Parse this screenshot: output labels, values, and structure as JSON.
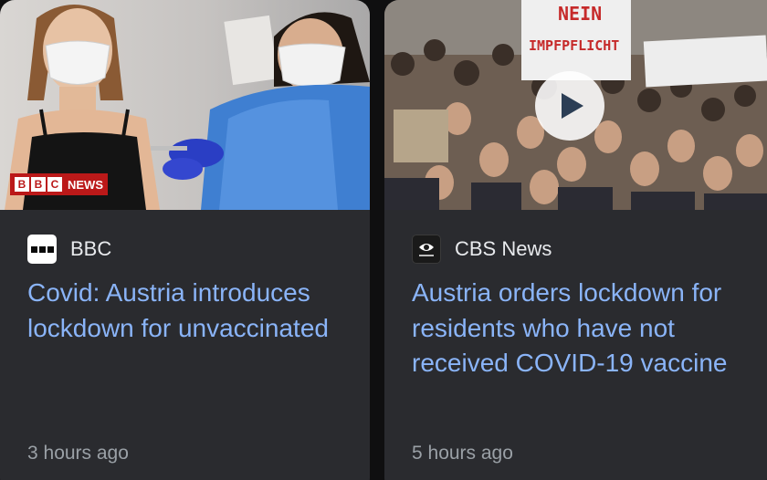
{
  "cards": [
    {
      "source": {
        "name": "BBC",
        "logo_icon": "bbc-logo-icon"
      },
      "thumbnail": {
        "icon": "vaccination-photo",
        "badge": {
          "letters": [
            "B",
            "B",
            "C"
          ],
          "label": "NEWS",
          "color": "#bb1919"
        }
      },
      "headline": "Covid: Austria introduces lockdown for unvaccinated",
      "time": "3 hours ago"
    },
    {
      "source": {
        "name": "CBS News",
        "logo_icon": "cbs-eye-logo-icon"
      },
      "thumbnail": {
        "icon": "protest-crowd-photo",
        "play_icon": "play-icon",
        "sign_text": [
          "NEIN",
          "IMPFPFLICHT"
        ]
      },
      "headline": "Austria orders lockdown for residents who have not received COVID-19 vaccine",
      "time": "5 hours ago"
    }
  ],
  "colors": {
    "card_background": "#2a2b2f",
    "headline": "#8ab4f8",
    "source_text": "#e8eaed",
    "time_text": "#9aa0a6"
  }
}
